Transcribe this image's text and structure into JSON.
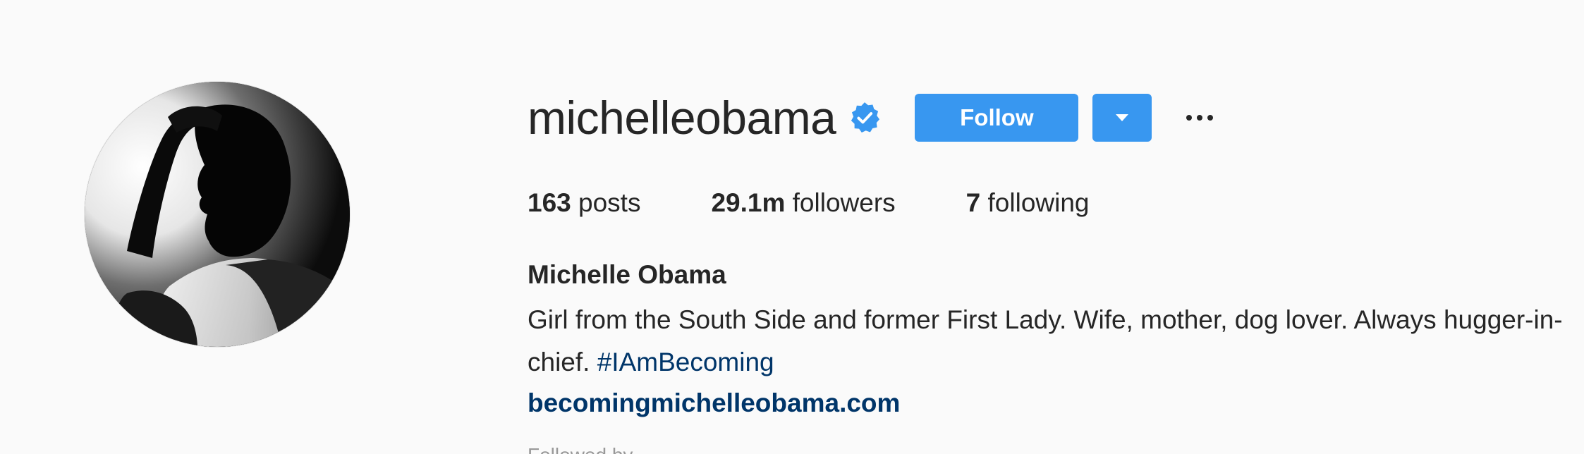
{
  "profile": {
    "username": "michelleobama",
    "verified": true,
    "avatar_alt": "profile-photo",
    "follow_label": "Follow",
    "more_icon": "ellipsis-icon",
    "dropdown_icon": "triangle-down-icon"
  },
  "stats": {
    "posts_count": "163",
    "posts_label": "posts",
    "followers_count": "29.1m",
    "followers_label": "followers",
    "following_count": "7",
    "following_label": "following"
  },
  "bio": {
    "full_name": "Michelle Obama",
    "text": "Girl from the South Side and former First Lady. Wife, mother, dog lover. Always hugger-in-chief.",
    "hashtag": "#IAmBecoming",
    "website": "becomingmichelleobama.com",
    "followed_by": "Followed by"
  },
  "colors": {
    "accent": "#3897f0",
    "link": "#003569",
    "background": "#fafafa",
    "text": "#262626"
  }
}
